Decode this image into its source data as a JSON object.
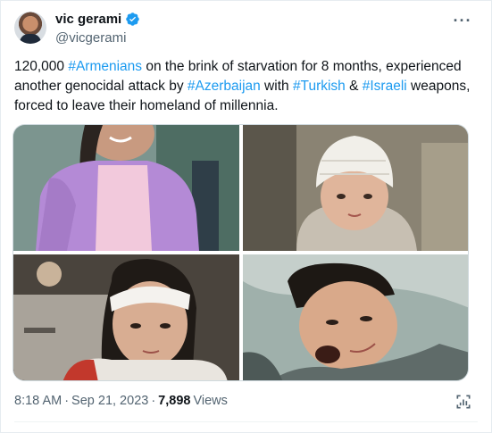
{
  "author": {
    "display_name": "vic gerami",
    "handle": "@vicgerami",
    "verified": true,
    "avatar_icon": "profile-photo"
  },
  "tweet": {
    "segments": [
      {
        "text": "120,000 ",
        "tag": false
      },
      {
        "text": "#Armenians",
        "tag": true
      },
      {
        "text": " on the brink of starvation for 8 months, experienced another genocidal attack by ",
        "tag": false
      },
      {
        "text": "#Azerbaijan",
        "tag": true
      },
      {
        "text": " with ",
        "tag": false
      },
      {
        "text": "#Turkish",
        "tag": true
      },
      {
        "text": " & ",
        "tag": false
      },
      {
        "text": "#Israeli",
        "tag": true
      },
      {
        "text": " weapons, forced to leave their homeland of millennia.",
        "tag": false
      }
    ]
  },
  "media": {
    "photos": [
      {
        "label": "photo-girl-purple-jacket"
      },
      {
        "label": "photo-child-bandaged-head"
      },
      {
        "label": "photo-girl-bandaged-forehead"
      },
      {
        "label": "photo-boy-in-blanket"
      }
    ]
  },
  "footer": {
    "time": "8:18 AM",
    "separator": "·",
    "date": "Sep 21, 2023",
    "separator2": "·",
    "views_count": "7,898",
    "views_label": "Views"
  },
  "colors": {
    "link": "#1d9bf0",
    "verified": "#1d9bf0",
    "muted": "#536471"
  },
  "more_label": "···"
}
